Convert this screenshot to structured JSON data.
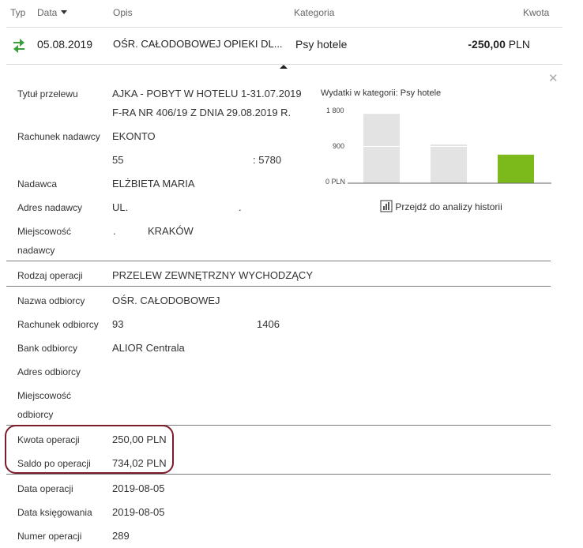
{
  "table_header": {
    "typ": "Typ",
    "data": "Data",
    "opis": "Opis",
    "kategoria": "Kategoria",
    "kwota": "Kwota"
  },
  "transaction": {
    "date": "05.08.2019",
    "description": "OŚR. CAŁODOBOWEJ OPIEKI DL...",
    "category": "Psy hotele",
    "amount": "-250,00",
    "currency": "PLN",
    "type_icon": "transfer-arrows-icon"
  },
  "details": {
    "tytul_label": "Tytuł przelewu",
    "tytul_line1": "AJKA - POBYT W HOTELU 1-31.07.2019",
    "tytul_line2": "F-RA NR 406/19 Z DNIA 29.08.2019 R.",
    "rachunek_nadawcy_label": "Rachunek nadawcy",
    "rachunek_nadawcy_name": "EKONTO",
    "rachunek_nadawcy_start": "55",
    "rachunek_nadawcy_end": ": 5780",
    "nadawca_label": "Nadawca",
    "nadawca_value": "ELŻBIETA MARIA",
    "adres_nadawcy_label": "Adres nadawcy",
    "adres_nadawcy_value": "UL.",
    "adres_nadawcy_dot": ".",
    "miejscowosc_nadawcy_label1": "Miejscowość",
    "miejscowosc_nadawcy_label2": "nadawcy",
    "miejscowosc_nadawcy_dot": ".",
    "miejscowosc_nadawcy_value": "KRAKÓW",
    "rodzaj_label": "Rodzaj operacji",
    "rodzaj_value": "PRZELEW ZEWNĘTRZNY WYCHODZĄCY",
    "nazwa_odbiorcy_label": "Nazwa odbiorcy",
    "nazwa_odbiorcy_value": "OŚR. CAŁODOBOWEJ",
    "rachunek_odbiorcy_label": "Rachunek odbiorcy",
    "rachunek_odbiorcy_start": "93",
    "rachunek_odbiorcy_end": "1406",
    "bank_label": "Bank odbiorcy",
    "bank_value": "ALIOR Centrala",
    "adres_odbiorcy_label": "Adres odbiorcy",
    "miejscowosc_odbiorcy_label1": "Miejscowość",
    "miejscowosc_odbiorcy_label2": "odbiorcy",
    "kwota_label": "Kwota operacji",
    "kwota_value": "250,00 PLN",
    "saldo_label": "Saldo po operacji",
    "saldo_value": "734,02 PLN",
    "data_operacji_label": "Data operacji",
    "data_operacji_value": "2019-08-05",
    "data_ksiegowania_label": "Data księgowania",
    "data_ksiegowania_value": "2019-08-05",
    "numer_label": "Numer operacji",
    "numer_value": "289"
  },
  "chart_data": {
    "type": "bar",
    "title": "Wydatki w kategorii:",
    "category_name": "Psy hotele",
    "yticks": [
      "1 800",
      "900",
      "0 PLN"
    ],
    "ylim": [
      0,
      1800
    ],
    "values": [
      1700,
      950,
      700
    ],
    "colors": [
      "#e3e3e3",
      "#e3e3e3",
      "#7cba1c"
    ]
  },
  "history_link": {
    "label": "Przejdź do analizy historii",
    "icon": "bar-chart-icon"
  },
  "close_icon": "close-icon",
  "colors": {
    "positive_green": "#3a9e3a",
    "highlight_border": "#7b1b2b"
  }
}
